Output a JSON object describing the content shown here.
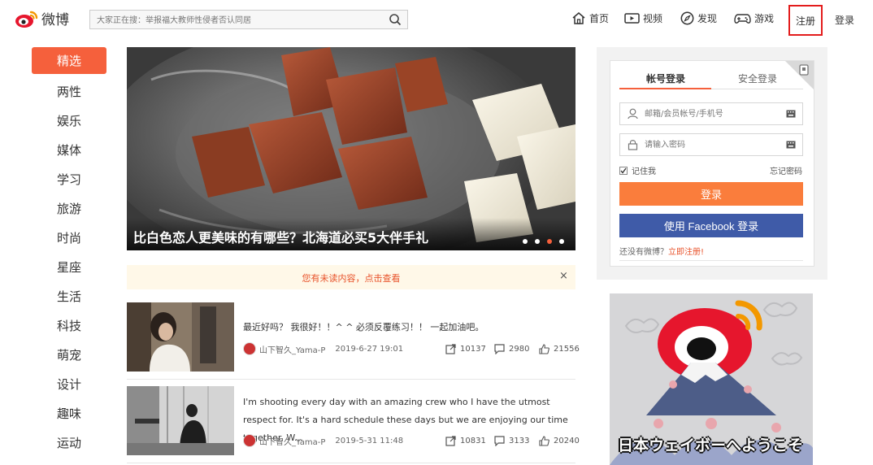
{
  "header": {
    "logo_text": "微博",
    "search_placeholder": "大家正在搜：举报福大教师性侵者否认同居",
    "nav": [
      {
        "label": "首页",
        "icon": "home-icon"
      },
      {
        "label": "视频",
        "icon": "video-icon"
      },
      {
        "label": "发现",
        "icon": "compass-icon"
      },
      {
        "label": "游戏",
        "icon": "gamepad-icon"
      }
    ],
    "register_label": "注册",
    "login_label": "登录"
  },
  "sidebar": {
    "items": [
      {
        "label": "精选",
        "active": true
      },
      {
        "label": "两性"
      },
      {
        "label": "娱乐"
      },
      {
        "label": "媒体"
      },
      {
        "label": "学习"
      },
      {
        "label": "旅游"
      },
      {
        "label": "时尚"
      },
      {
        "label": "星座"
      },
      {
        "label": "生活"
      },
      {
        "label": "科技"
      },
      {
        "label": "萌宠"
      },
      {
        "label": "设计"
      },
      {
        "label": "趣味"
      },
      {
        "label": "运动"
      }
    ]
  },
  "banner": {
    "title": "比白色恋人更美味的有哪些？北海道必买5大伴手礼",
    "slides": 4,
    "active_slide": 3
  },
  "notice": {
    "text": "您有未读内容，点击查看",
    "close_label": "×"
  },
  "feed": [
    {
      "text": "最近好吗？ 我很好！！^ ^ 必须反覆练习！！ 一起加油吧。",
      "author": "山下智久_Yama-P",
      "date": "2019-6-27 19:01",
      "reposts": "10137",
      "comments": "2980",
      "likes": "21556"
    },
    {
      "text": "I'm shooting every day with an amazing crew who I have the utmost respect for. It's a hard schedule these days but we are enjoying our time together. W...",
      "author": "山下智久_Yama-P",
      "date": "2019-5-31 11:48",
      "reposts": "10831",
      "comments": "3133",
      "likes": "20240"
    }
  ],
  "login_panel": {
    "tab_account": "帐号登录",
    "tab_secure": "安全登录",
    "username_placeholder": "邮箱/会员帐号/手机号",
    "password_placeholder": "请输入密码",
    "remember_label": "记住我",
    "remember_checked": true,
    "forgot_label": "忘记密码",
    "login_button": "登录",
    "facebook_button": "使用 Facebook 登录",
    "no_account_text": "还没有微博？",
    "register_now_link": "立即注册!"
  },
  "promo": {
    "text": "日本ウェイボーへようこそ"
  },
  "colors": {
    "accent": "#f5603c",
    "login_button": "#fa7d3c",
    "facebook": "#3f5ba8",
    "register_highlight": "#e31c1c"
  }
}
